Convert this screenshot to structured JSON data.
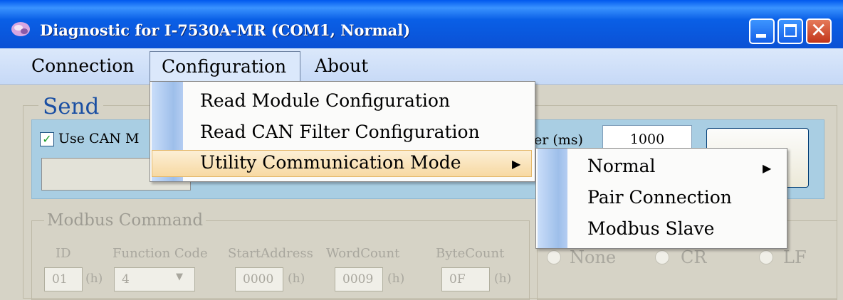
{
  "window": {
    "title": "Diagnostic for I-7530A-MR (COM1, Normal)"
  },
  "menubar": {
    "connection": "Connection",
    "configuration": "Configuration",
    "about": "About"
  },
  "config_menu": {
    "items": [
      "Read Module Configuration",
      "Read CAN Filter Configuration",
      "Utility Communication Mode"
    ]
  },
  "mode_menu": {
    "items": [
      "Normal",
      "Pair Connection",
      "Modbus Slave"
    ]
  },
  "send": {
    "title": "Send",
    "use_can_label": "Use CAN M",
    "use_can_checked": true,
    "timer_label": "er (ms)",
    "timer_value": "1000"
  },
  "modbus": {
    "title": "Modbus Command",
    "labels": [
      "ID",
      "Function Code",
      "StartAddress",
      "WordCount",
      "ByteCount"
    ],
    "values": {
      "id": "01",
      "function_code": "4",
      "start_address": "0000",
      "word_count": "0009",
      "byte_count": "0F"
    },
    "hex_suffix": "(h)"
  },
  "terminator": {
    "options": [
      "None",
      "CR",
      "LF"
    ]
  },
  "icons": {
    "check": "✓",
    "submenu_arrow": "▶",
    "close": "✕"
  },
  "colors": {
    "titlebar": "#0b52d6",
    "menubar": "#c6d9f6",
    "send_band": "#a9cee3",
    "menu_highlight": "#f7d9a2"
  }
}
